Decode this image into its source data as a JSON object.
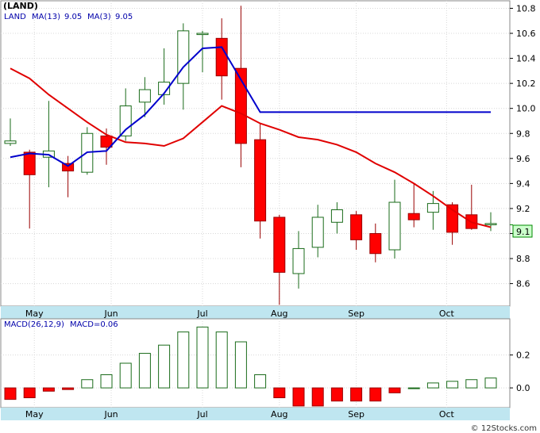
{
  "title": "(LAND)",
  "footer": "© 12Stocks.com",
  "colors": {
    "up": "#ffffff",
    "up_stroke": "#1a6b1a",
    "down": "#ff0000",
    "down_stroke": "#990000",
    "ma13": "#e00000",
    "ma3": "#0000cc",
    "axis_band": "#bfe6f0",
    "grid": "#d8d8d8",
    "current_box": "#ccffcc"
  },
  "chart_data": [
    {
      "type": "candlestick",
      "legend": {
        "symbol": "LAND",
        "ma13_label": "MA(13)",
        "ma13_value": "9.05",
        "ma3_label": "MA(3)",
        "ma3_value": "9.05"
      },
      "ylim": [
        8.42,
        10.86
      ],
      "yticks": [
        8.6,
        8.8,
        9.0,
        9.2,
        9.4,
        9.6,
        9.8,
        10.0,
        10.2,
        10.4,
        10.6,
        10.8
      ],
      "ytick_labels": [
        "8.6",
        "8.8",
        "",
        "9.2",
        "9.4",
        "9.6",
        "9.8",
        "10.0",
        "10.2",
        "10.4",
        "10.6",
        "10.8"
      ],
      "current_value": "9.1",
      "current_price": 9.07,
      "xtick_labels": [
        "May",
        "Jun",
        "Jul",
        "Aug",
        "Sep",
        "Oct"
      ],
      "xtick_index": [
        1.25,
        5.25,
        10,
        14,
        18,
        22.7
      ],
      "candles": [
        {
          "o": 9.72,
          "h": 9.92,
          "l": 9.7,
          "c": 9.74
        },
        {
          "o": 9.65,
          "h": 9.67,
          "l": 9.04,
          "c": 9.47
        },
        {
          "o": 9.61,
          "h": 10.06,
          "l": 9.37,
          "c": 9.66
        },
        {
          "o": 9.56,
          "h": 9.62,
          "l": 9.29,
          "c": 9.5
        },
        {
          "o": 9.49,
          "h": 9.85,
          "l": 9.47,
          "c": 9.8
        },
        {
          "o": 9.78,
          "h": 9.84,
          "l": 9.55,
          "c": 9.69
        },
        {
          "o": 9.78,
          "h": 10.16,
          "l": 9.74,
          "c": 10.02
        },
        {
          "o": 10.05,
          "h": 10.25,
          "l": 9.93,
          "c": 10.15
        },
        {
          "o": 10.11,
          "h": 10.48,
          "l": 10.03,
          "c": 10.21
        },
        {
          "o": 10.2,
          "h": 10.68,
          "l": 9.99,
          "c": 10.62
        },
        {
          "o": 10.59,
          "h": 10.62,
          "l": 10.29,
          "c": 10.6
        },
        {
          "o": 10.56,
          "h": 10.72,
          "l": 10.07,
          "c": 10.26
        },
        {
          "o": 10.32,
          "h": 10.82,
          "l": 9.53,
          "c": 9.72
        },
        {
          "o": 9.75,
          "h": 9.88,
          "l": 8.96,
          "c": 9.1
        },
        {
          "o": 9.13,
          "h": 9.15,
          "l": 8.43,
          "c": 8.69
        },
        {
          "o": 8.68,
          "h": 9.02,
          "l": 8.56,
          "c": 8.88
        },
        {
          "o": 8.89,
          "h": 9.23,
          "l": 8.81,
          "c": 9.13
        },
        {
          "o": 9.09,
          "h": 9.25,
          "l": 9.0,
          "c": 9.19
        },
        {
          "o": 9.15,
          "h": 9.18,
          "l": 8.87,
          "c": 8.95
        },
        {
          "o": 9.0,
          "h": 9.08,
          "l": 8.77,
          "c": 8.84
        },
        {
          "o": 8.87,
          "h": 9.43,
          "l": 8.8,
          "c": 9.25
        },
        {
          "o": 9.16,
          "h": 9.4,
          "l": 9.05,
          "c": 9.11
        },
        {
          "o": 9.17,
          "h": 9.34,
          "l": 9.03,
          "c": 9.24
        },
        {
          "o": 9.23,
          "h": 9.25,
          "l": 8.91,
          "c": 9.01
        },
        {
          "o": 9.15,
          "h": 9.39,
          "l": 9.03,
          "c": 9.04
        },
        {
          "o": 9.07,
          "h": 9.17,
          "l": 9.02,
          "c": 9.08
        }
      ],
      "ma13": [
        10.32,
        10.24,
        10.11,
        10.0,
        9.89,
        9.79,
        9.73,
        9.72,
        9.7,
        9.76,
        9.89,
        10.02,
        9.96,
        9.88,
        9.83,
        9.77,
        9.75,
        9.71,
        9.65,
        9.56,
        9.49,
        9.4,
        9.3,
        9.19,
        9.09,
        9.05
      ],
      "ma3": [
        9.61,
        9.64,
        9.63,
        9.54,
        9.65,
        9.66,
        9.83,
        9.95,
        10.12,
        10.33,
        10.48,
        10.49,
        null,
        9.97,
        9.97,
        9.97,
        9.97,
        9.97,
        9.97,
        9.97,
        9.97,
        9.97,
        9.97,
        9.97,
        9.97,
        9.97
      ]
    },
    {
      "type": "bar",
      "legend": {
        "label": "MACD(26,12,9)",
        "value_label": "MACD=0.06"
      },
      "ylim": [
        -0.12,
        0.42
      ],
      "yticks": [
        0.0,
        0.2
      ],
      "ytick_labels": [
        "0.0",
        "0.2"
      ],
      "xtick_labels": [
        "May",
        "Jun",
        "Jul",
        "Aug",
        "Sep",
        "Oct"
      ],
      "values": [
        -0.07,
        -0.06,
        -0.02,
        -0.01,
        0.05,
        0.08,
        0.15,
        0.21,
        0.26,
        0.34,
        0.37,
        0.34,
        0.28,
        0.08,
        -0.06,
        -0.11,
        -0.11,
        -0.08,
        -0.08,
        -0.08,
        -0.03,
        0.0,
        0.03,
        0.04,
        0.05,
        0.06
      ]
    }
  ]
}
